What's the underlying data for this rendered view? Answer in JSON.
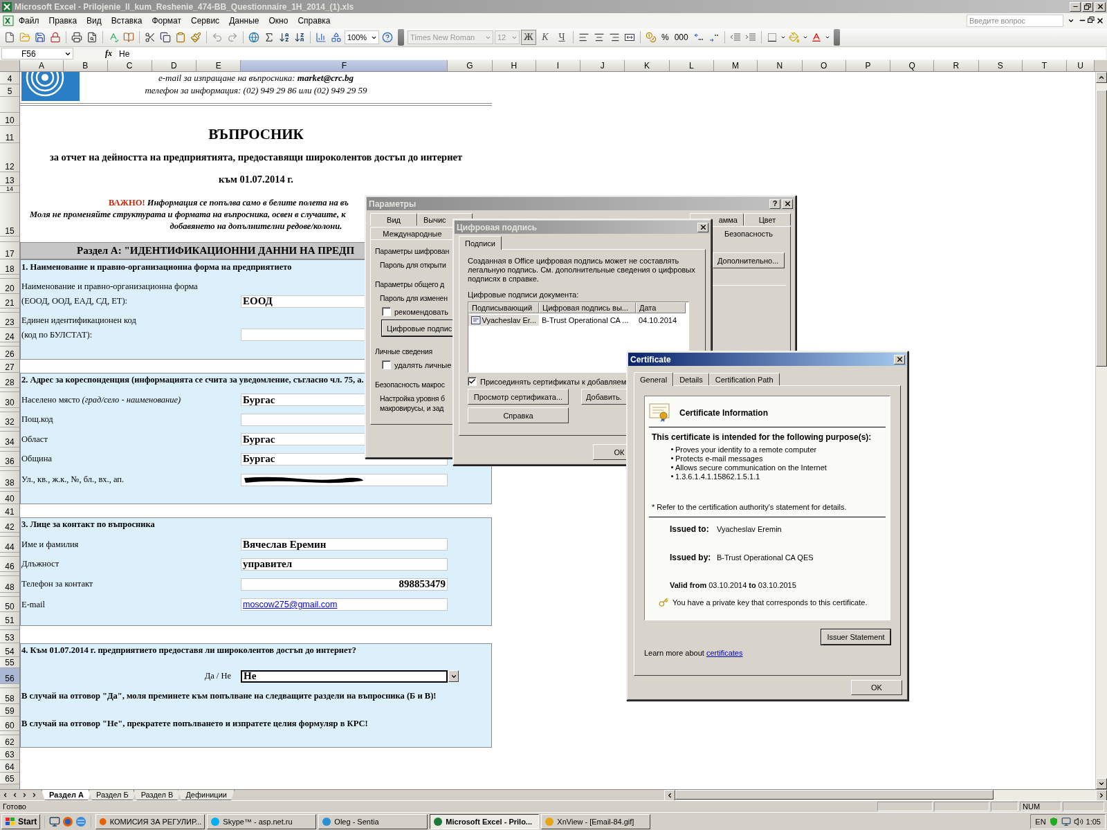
{
  "window": {
    "title": "Microsoft Excel - Prilojenie_II_kum_Reshenie_474-BB_Questionnaire_1H_2014_(1).xls",
    "active": false
  },
  "menu": [
    "Файл",
    "Правка",
    "Вид",
    "Вставка",
    "Формат",
    "Сервис",
    "Данные",
    "Окно",
    "Справка"
  ],
  "help_search": {
    "placeholder": "Введите вопрос"
  },
  "toolbar": {
    "zoom": "100%",
    "font": "Times New Roman",
    "size": "12",
    "format_buttons": [
      {
        "label": "Ж",
        "selected": true
      },
      {
        "label": "К",
        "selected": false
      },
      {
        "label": "Ч",
        "selected": false
      }
    ],
    "number_buttons": [
      "%",
      "000"
    ]
  },
  "formula_bar": {
    "cell": "F56",
    "function_symbol": "fx",
    "value": "Не"
  },
  "columns": [
    {
      "label": "A",
      "selected": false
    },
    {
      "label": "B",
      "selected": false
    },
    {
      "label": "C",
      "selected": false
    },
    {
      "label": "D",
      "selected": false
    },
    {
      "label": "E",
      "selected": false
    },
    {
      "label": "F",
      "selected": true
    },
    {
      "label": "G",
      "selected": false
    },
    {
      "label": "H",
      "selected": false
    },
    {
      "label": "I",
      "selected": false
    },
    {
      "label": "J",
      "selected": false
    },
    {
      "label": "K",
      "selected": false
    },
    {
      "label": "L",
      "selected": false
    },
    {
      "label": "M",
      "selected": false
    },
    {
      "label": "N",
      "selected": false
    },
    {
      "label": "O",
      "selected": false
    },
    {
      "label": "P",
      "selected": false
    },
    {
      "label": "Q",
      "selected": false
    },
    {
      "label": "R",
      "selected": false
    },
    {
      "label": "S",
      "selected": false
    },
    {
      "label": "T",
      "selected": false
    },
    {
      "label": "U",
      "selected": false
    }
  ],
  "rows": [
    {
      "number": "4",
      "selected": false,
      "kind": "plain",
      "caption": "e-mail за изпращане на въпросника:  **market@crc.bg**"
    },
    {
      "number": "5",
      "selected": false,
      "kind": "plain",
      "caption": "телефон за информация: (02) 949 29 86 или (02) 949 29 59"
    },
    {
      "kind": "rule"
    },
    {
      "number": "10",
      "selected": false,
      "kind": "plain"
    },
    {
      "number": "11",
      "selected": false,
      "kind": "plain",
      "title": "ВЪПРОСНИК"
    },
    {
      "number": "12",
      "selected": false,
      "kind": "plain",
      "subtitle": "за отчет на дейността на предприятията, предоставящи широколентов достъп до интернет"
    },
    {
      "number": "13",
      "selected": false,
      "kind": "plain",
      "subtitle": "към 01.07.2014 г."
    },
    {
      "number": "14",
      "selected": false,
      "kind": "plain"
    },
    {
      "number": "15",
      "selected": false,
      "kind": "plain",
      "notice": {
        "highlight": "ВАЖНО!",
        "lines": [
          "Информация се попълва само в белите полета на въ",
          "Моля не променяйте структурата и формата на въпросника, освен в случаите, к",
          "добавянето на допълнителни редове/колони."
        ]
      }
    },
    {
      "kind": "plain"
    },
    {
      "number": "17",
      "selected": false,
      "kind": "band",
      "band": "Раздел А: \"ИДЕНТИФИКАЦИОННИ ДАННИ НА ПРЕДП"
    },
    {
      "number": "18",
      "selected": false,
      "kind": "panel",
      "question": "1. Наименование и правно-организационна форма на предприятието"
    },
    {
      "kind": "panel"
    },
    {
      "number": "20",
      "selected": false,
      "kind": "panel",
      "label": "Наименование и правно-организационна форма"
    },
    {
      "number": "21",
      "selected": false,
      "kind": "panel",
      "label": "(ЕООД, ООД, ЕАД, СД, ЕТ):",
      "field": {
        "kind": "text",
        "value": "ЕООД",
        "selected": false
      }
    },
    {
      "kind": "panel"
    },
    {
      "number": "23",
      "selected": false,
      "kind": "panel",
      "label": "Единен идентификационен код"
    },
    {
      "number": "24",
      "selected": false,
      "kind": "panel",
      "label": "(код по БУЛСТАТ):",
      "field": {
        "kind": "empty",
        "selected": false
      }
    },
    {
      "kind": "panel"
    },
    {
      "number": "26",
      "selected": false,
      "kind": "panel"
    },
    {
      "number": "27",
      "selected": false,
      "kind": "plain"
    },
    {
      "number": "28",
      "selected": false,
      "kind": "panel",
      "question": "2. Адрес за кореспонденция (информацията се счита за уведомление, съгласно чл. 75, а."
    },
    {
      "kind": "panel"
    },
    {
      "number": "30",
      "selected": false,
      "kind": "panel",
      "label": "Населено място *(град/село - наименование)*",
      "field": {
        "kind": "text",
        "value": "Бургас",
        "selected": false
      }
    },
    {
      "kind": "panel"
    },
    {
      "number": "32",
      "selected": false,
      "kind": "panel",
      "label": "Пощ.код",
      "field": {
        "kind": "empty",
        "selected": false
      }
    },
    {
      "kind": "panel"
    },
    {
      "number": "34",
      "selected": false,
      "kind": "panel",
      "label": "Област",
      "field": {
        "kind": "text",
        "value": "Бургас",
        "selected": false
      }
    },
    {
      "kind": "panel"
    },
    {
      "number": "36",
      "selected": false,
      "kind": "panel",
      "label": "Община",
      "field": {
        "kind": "text",
        "value": "Бургас",
        "selected": false
      }
    },
    {
      "kind": "panel"
    },
    {
      "number": "38",
      "selected": false,
      "kind": "panel",
      "label": "Ул., кв., ж.к., №, бл., вх., ап.",
      "field": {
        "kind": "redacted",
        "selected": false
      }
    },
    {
      "kind": "panel"
    },
    {
      "number": "40",
      "selected": false,
      "kind": "panel"
    },
    {
      "number": "41",
      "selected": false,
      "kind": "plain"
    },
    {
      "number": "42",
      "selected": false,
      "kind": "panel",
      "question": "3. Лице за контакт по въпросника"
    },
    {
      "kind": "panel"
    },
    {
      "number": "44",
      "selected": false,
      "kind": "panel",
      "label": "Име и фамилия",
      "field": {
        "kind": "text",
        "value": "Вячеслав Еремин",
        "selected": false
      }
    },
    {
      "kind": "panel"
    },
    {
      "number": "46",
      "selected": false,
      "kind": "panel",
      "label": "Длъжност",
      "field": {
        "kind": "text",
        "value": "управител",
        "selected": false
      }
    },
    {
      "kind": "panel"
    },
    {
      "number": "48",
      "selected": false,
      "kind": "panel",
      "label": "Телефон за контакт",
      "field": {
        "kind": "number",
        "value": "898853479",
        "selected": false
      }
    },
    {
      "kind": "panel"
    },
    {
      "number": "50",
      "selected": false,
      "kind": "panel",
      "label": "E-mail",
      "field": {
        "kind": "link",
        "value": "moscow275@gmail.com",
        "selected": false
      }
    },
    {
      "number": "51",
      "selected": false,
      "kind": "panel"
    },
    {
      "kind": "plain"
    },
    {
      "number": "53",
      "selected": false,
      "kind": "plain"
    },
    {
      "number": "54",
      "selected": false,
      "kind": "panel",
      "question": "4. Към 01.07.2014 г. предприятието предоставя ли широколентов достъп до интернет?"
    },
    {
      "number": "55",
      "selected": false,
      "kind": "panel"
    },
    {
      "number": "56",
      "selected": true,
      "kind": "panel",
      "side_label": "Да / Не",
      "field": {
        "kind": "dropdown",
        "value": "Не",
        "selected": true
      }
    },
    {
      "kind": "panel"
    },
    {
      "number": "58",
      "selected": false,
      "kind": "panel",
      "question": "В случай на отговор \"Да\", моля преминете към попълване на следващите раздели на въпросника (Б и В)!"
    },
    {
      "number": "59",
      "selected": false,
      "kind": "panel"
    },
    {
      "number": "60",
      "selected": false,
      "kind": "panel",
      "question": "В случай на отговор \"Не\", прекратете попълването и изпратете целия формуляр в КРС!"
    },
    {
      "kind": "panel"
    },
    {
      "number": "62",
      "selected": false,
      "kind": "panel"
    },
    {
      "number": "63",
      "selected": false,
      "kind": "plain"
    },
    {
      "number": "64",
      "selected": false,
      "kind": "plain"
    },
    {
      "number": "65",
      "selected": false,
      "kind": "plain"
    }
  ],
  "sheet_tabs": [
    {
      "label": "Раздел А",
      "selected": true
    },
    {
      "label": "Раздел Б",
      "selected": false
    },
    {
      "label": "Раздел В",
      "selected": false
    },
    {
      "label": "Дефиниции",
      "selected": false
    }
  ],
  "status_bar": {
    "status": "Готово",
    "indicator": "NUM"
  },
  "options_dialog": {
    "title": "Параметры",
    "active": false,
    "help_button": "?",
    "tabs": [
      {
        "label": "Вид",
        "selected": false
      },
      {
        "label": "Вычис",
        "selected": false
      },
      {
        "label": "амма",
        "selected": false
      },
      {
        "label": "Цвет",
        "selected": false
      },
      {
        "label": "Международные",
        "selected": false
      },
      {
        "label": "Безопасность",
        "selected": true
      }
    ],
    "items": [
      {
        "kind": "heading",
        "text": "Параметры шифрован"
      },
      {
        "kind": "text",
        "text": "Пароль для открыти"
      },
      {
        "kind": "heading",
        "text": "Параметры общего д"
      },
      {
        "kind": "text",
        "text": "Пароль для изменен"
      },
      {
        "kind": "checkbox",
        "text": "рекомендовать",
        "checked": false
      },
      {
        "kind": "button",
        "text": "Цифровые подпис"
      },
      {
        "kind": "heading",
        "text": "Личные сведения"
      },
      {
        "kind": "checkbox",
        "text": "удалять личные",
        "checked": false
      },
      {
        "kind": "heading",
        "text": "Безопасность макрос"
      },
      {
        "kind": "text",
        "text": "Настройка уровня б"
      },
      {
        "kind": "text",
        "text": "макровирусы, и зад"
      }
    ],
    "more_button": "Дополнительно..."
  },
  "signature_dialog": {
    "title": "Цифровая подпись",
    "active": false,
    "tabs": [
      {
        "label": "Подписи",
        "selected": true
      }
    ],
    "description": "Созданная в Office цифровая подпись может не составлять легальную подпись. См. дополнительные сведения о цифровых подписях в справке.",
    "list_label": "Цифровые подписи документа:",
    "columns": [
      "Подписывающий",
      "Цифровая подпись вы...",
      "Дата"
    ],
    "signatures": [
      {
        "signer": "Vyacheslav Er...",
        "issuer": "B-Trust Operational CA ...",
        "date": "04.10.2014",
        "selected": true
      }
    ],
    "attach": {
      "label": "Присоединять сертификаты к добавляем",
      "checked": true
    },
    "buttons": [
      "Просмотр сертификата...",
      "Добавить.",
      "Справка"
    ],
    "ok": "ОК"
  },
  "certificate_dialog": {
    "title": "Certificate",
    "active": true,
    "tabs": [
      {
        "label": "General",
        "selected": true
      },
      {
        "label": "Details",
        "selected": false
      },
      {
        "label": "Certification Path",
        "selected": false
      }
    ],
    "heading": "Certificate Information",
    "purpose_title": "This certificate is intended for the following purpose(s):",
    "purposes": [
      "Proves your identity to a remote computer",
      "Protects e-mail messages",
      "Allows secure communication on the Internet",
      "1.3.6.1.4.1.15862.1.5.1.1"
    ],
    "note": "* Refer to the certification authority's statement for details.",
    "issued_to": {
      "label": "Issued to:",
      "value": "Vyacheslav Eremin"
    },
    "issued_by": {
      "label": "Issued by:",
      "value": "B-Trust Operational CA QES"
    },
    "valid": "**Valid from** 03.10.2014  **to**  03.10.2015",
    "private_key": "You have a private key that corresponds to this certificate.",
    "issuer_button": "Issuer Statement",
    "learn_more": "Learn more about",
    "learn_link": "certificates",
    "ok": "OK"
  },
  "taskbar": {
    "start": "Start",
    "tasks": [
      {
        "label": "КОМИСИЯ ЗА РЕГУЛИР...",
        "selected": false
      },
      {
        "label": "Skype™ - asp.net.ru",
        "selected": false
      },
      {
        "label": "Oleg - Sentia",
        "selected": false
      },
      {
        "label": "Microsoft Excel - Prilo...",
        "selected": true
      },
      {
        "label": "XnView - [Email-84.gif]",
        "selected": false
      }
    ],
    "language": "EN",
    "clock": "1:05"
  }
}
